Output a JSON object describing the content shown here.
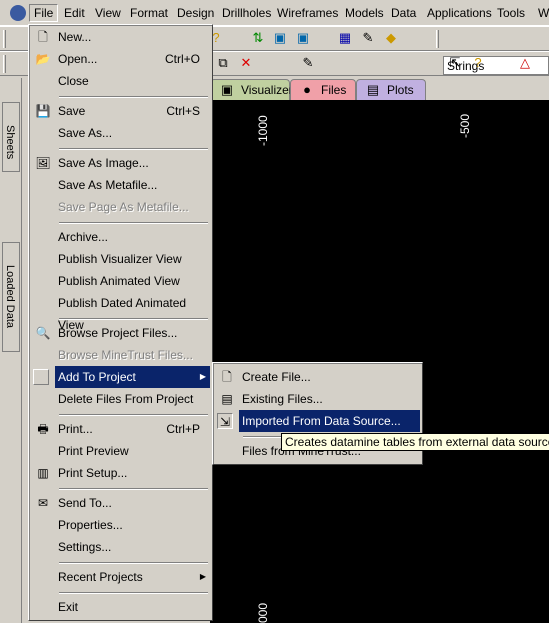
{
  "menubar": [
    "File",
    "Edit",
    "View",
    "Format",
    "Design",
    "Drillholes",
    "Wireframes",
    "Models",
    "Data",
    "Applications",
    "Tools",
    "Wi"
  ],
  "toolbar": {
    "strings_value": "Strings"
  },
  "tabs": [
    {
      "label": "Visualizer",
      "color": "#c0d0a0"
    },
    {
      "label": "Files",
      "color": "#f0a0a8"
    },
    {
      "label": "Plots",
      "color": "#c0b0e0"
    }
  ],
  "side_tabs": [
    "Sheets",
    "Loaded Data"
  ],
  "viewport": {
    "labels": [
      "-1000",
      "-500",
      "000"
    ]
  },
  "file_menu": [
    {
      "label": "New...",
      "icon": "new-file-icon"
    },
    {
      "label": "Open...",
      "shortcut": "Ctrl+O",
      "icon": "open-folder-icon"
    },
    {
      "label": "Close"
    },
    {
      "sep": true
    },
    {
      "label": "Save",
      "shortcut": "Ctrl+S",
      "icon": "save-icon"
    },
    {
      "label": "Save As..."
    },
    {
      "sep": true
    },
    {
      "label": "Save As Image...",
      "icon": "image-icon"
    },
    {
      "label": "Save As Metafile..."
    },
    {
      "label": "Save Page As Metafile...",
      "disabled": true
    },
    {
      "sep": true
    },
    {
      "label": "Archive..."
    },
    {
      "label": "Publish Visualizer View"
    },
    {
      "label": "Publish Animated View"
    },
    {
      "label": "Publish Dated Animated View"
    },
    {
      "sep": true
    },
    {
      "label": "Browse Project Files...",
      "icon": "browse-icon"
    },
    {
      "label": "Browse MineTrust Files...",
      "disabled": true
    },
    {
      "label": "Add To Project",
      "submenu": true,
      "highlighted": true
    },
    {
      "label": "Delete Files From Project"
    },
    {
      "sep": true
    },
    {
      "label": "Print...",
      "shortcut": "Ctrl+P",
      "icon": "print-icon"
    },
    {
      "label": "Print Preview"
    },
    {
      "label": "Print Setup...",
      "icon": "print-setup-icon"
    },
    {
      "sep": true
    },
    {
      "label": "Send To...",
      "icon": "send-icon"
    },
    {
      "label": "Properties..."
    },
    {
      "label": "Settings..."
    },
    {
      "sep": true
    },
    {
      "label": "Recent Projects",
      "submenu": true
    },
    {
      "sep": true
    },
    {
      "label": "Exit"
    }
  ],
  "submenu": [
    {
      "label": "Create File...",
      "icon": "create-file-icon"
    },
    {
      "label": "Existing Files...",
      "icon": "existing-files-icon"
    },
    {
      "label": "Imported From Data Source...",
      "icon": "import-icon",
      "highlighted": true
    },
    {
      "sep": true
    },
    {
      "label": "Files from MineTrust..."
    }
  ],
  "tooltip": "Creates datamine tables from external data sources"
}
